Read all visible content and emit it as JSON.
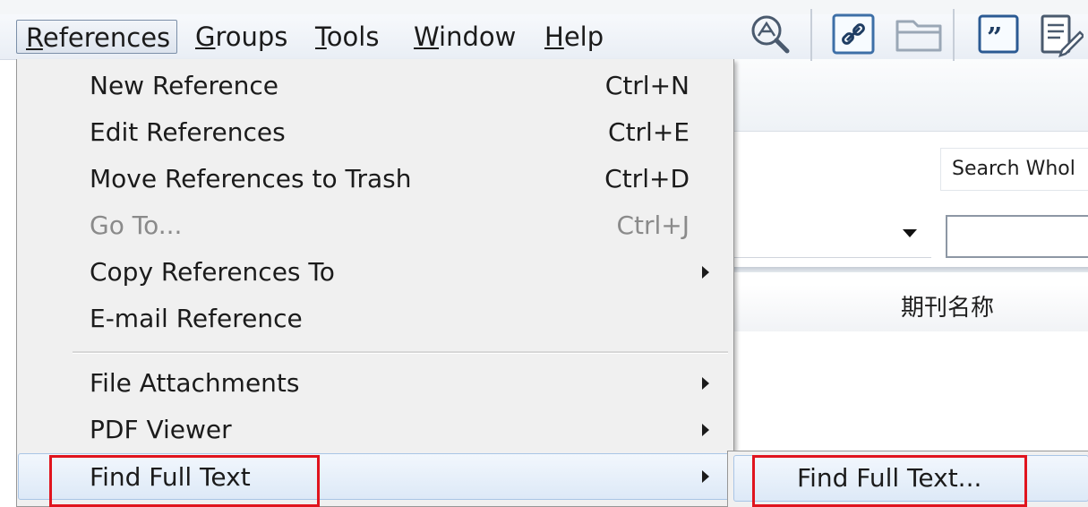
{
  "menubar": {
    "items": [
      {
        "label": "References",
        "mnemonic": "R"
      },
      {
        "label": "Groups",
        "mnemonic": "G"
      },
      {
        "label": "Tools",
        "mnemonic": "T"
      },
      {
        "label": "Window",
        "mnemonic": "W"
      },
      {
        "label": "Help",
        "mnemonic": "H"
      }
    ]
  },
  "references_menu": {
    "items": [
      {
        "label": "New Reference",
        "shortcut": "Ctrl+N",
        "enabled": true
      },
      {
        "label": "Edit References",
        "shortcut": "Ctrl+E",
        "enabled": true
      },
      {
        "label": "Move References to Trash",
        "shortcut": "Ctrl+D",
        "enabled": true
      },
      {
        "label": "Go To...",
        "shortcut": "Ctrl+J",
        "enabled": false
      },
      {
        "label": "Copy References To",
        "submenu": true,
        "enabled": true
      },
      {
        "label": "E-mail Reference",
        "enabled": true
      },
      {
        "label": "File Attachments",
        "submenu": true,
        "enabled": true
      },
      {
        "label": "PDF Viewer",
        "submenu": true,
        "enabled": true
      },
      {
        "label": "Find Full Text",
        "submenu": true,
        "enabled": true,
        "highlighted": true
      }
    ]
  },
  "find_full_text_submenu": {
    "items": [
      {
        "label": "Find Full Text...",
        "highlighted": true
      }
    ]
  },
  "background": {
    "search_scope": "Search Whol",
    "column_header": "期刊名称",
    "toolbar_icons": [
      "online-search-icon",
      "link-icon",
      "folder-icon",
      "quote-icon",
      "edit-document-icon"
    ]
  },
  "annotation_color": "#e0141e"
}
